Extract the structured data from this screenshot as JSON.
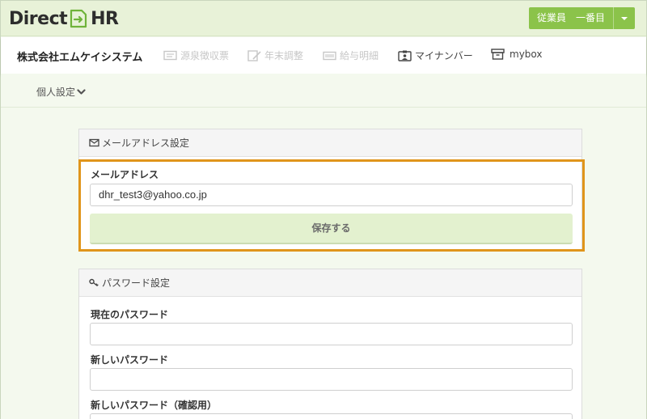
{
  "app": {
    "logo_left": "Direct",
    "logo_right": "HR",
    "user_label": "従業員　一番目"
  },
  "nav": {
    "company": "株式会社エムケイシステム",
    "items": [
      {
        "label": "源泉徴収票",
        "icon": "receipt-icon",
        "enabled": false
      },
      {
        "label": "年末調整",
        "icon": "edit-doc-icon",
        "enabled": false
      },
      {
        "label": "給与明細",
        "icon": "payslip-icon",
        "enabled": false
      },
      {
        "label": "マイナンバー",
        "icon": "id-card-icon",
        "enabled": true
      },
      {
        "label": "mybox",
        "icon": "box-icon",
        "enabled": true
      }
    ]
  },
  "subnav": {
    "personal_settings": "個人設定"
  },
  "email_panel": {
    "title": "メールアドレス設定",
    "field_label": "メールアドレス",
    "email_value": "dhr_test3@yahoo.co.jp",
    "save_label": "保存する"
  },
  "password_panel": {
    "title": "パスワード設定",
    "current_label": "現在のパスワード",
    "new_label": "新しいパスワード",
    "confirm_label": "新しいパスワード（確認用）"
  },
  "colors": {
    "accent_green": "#8bc34a",
    "topbar_bg": "#e8f2d8",
    "highlight": "#e0951b",
    "save_btn_bg": "#e3f1cf"
  }
}
